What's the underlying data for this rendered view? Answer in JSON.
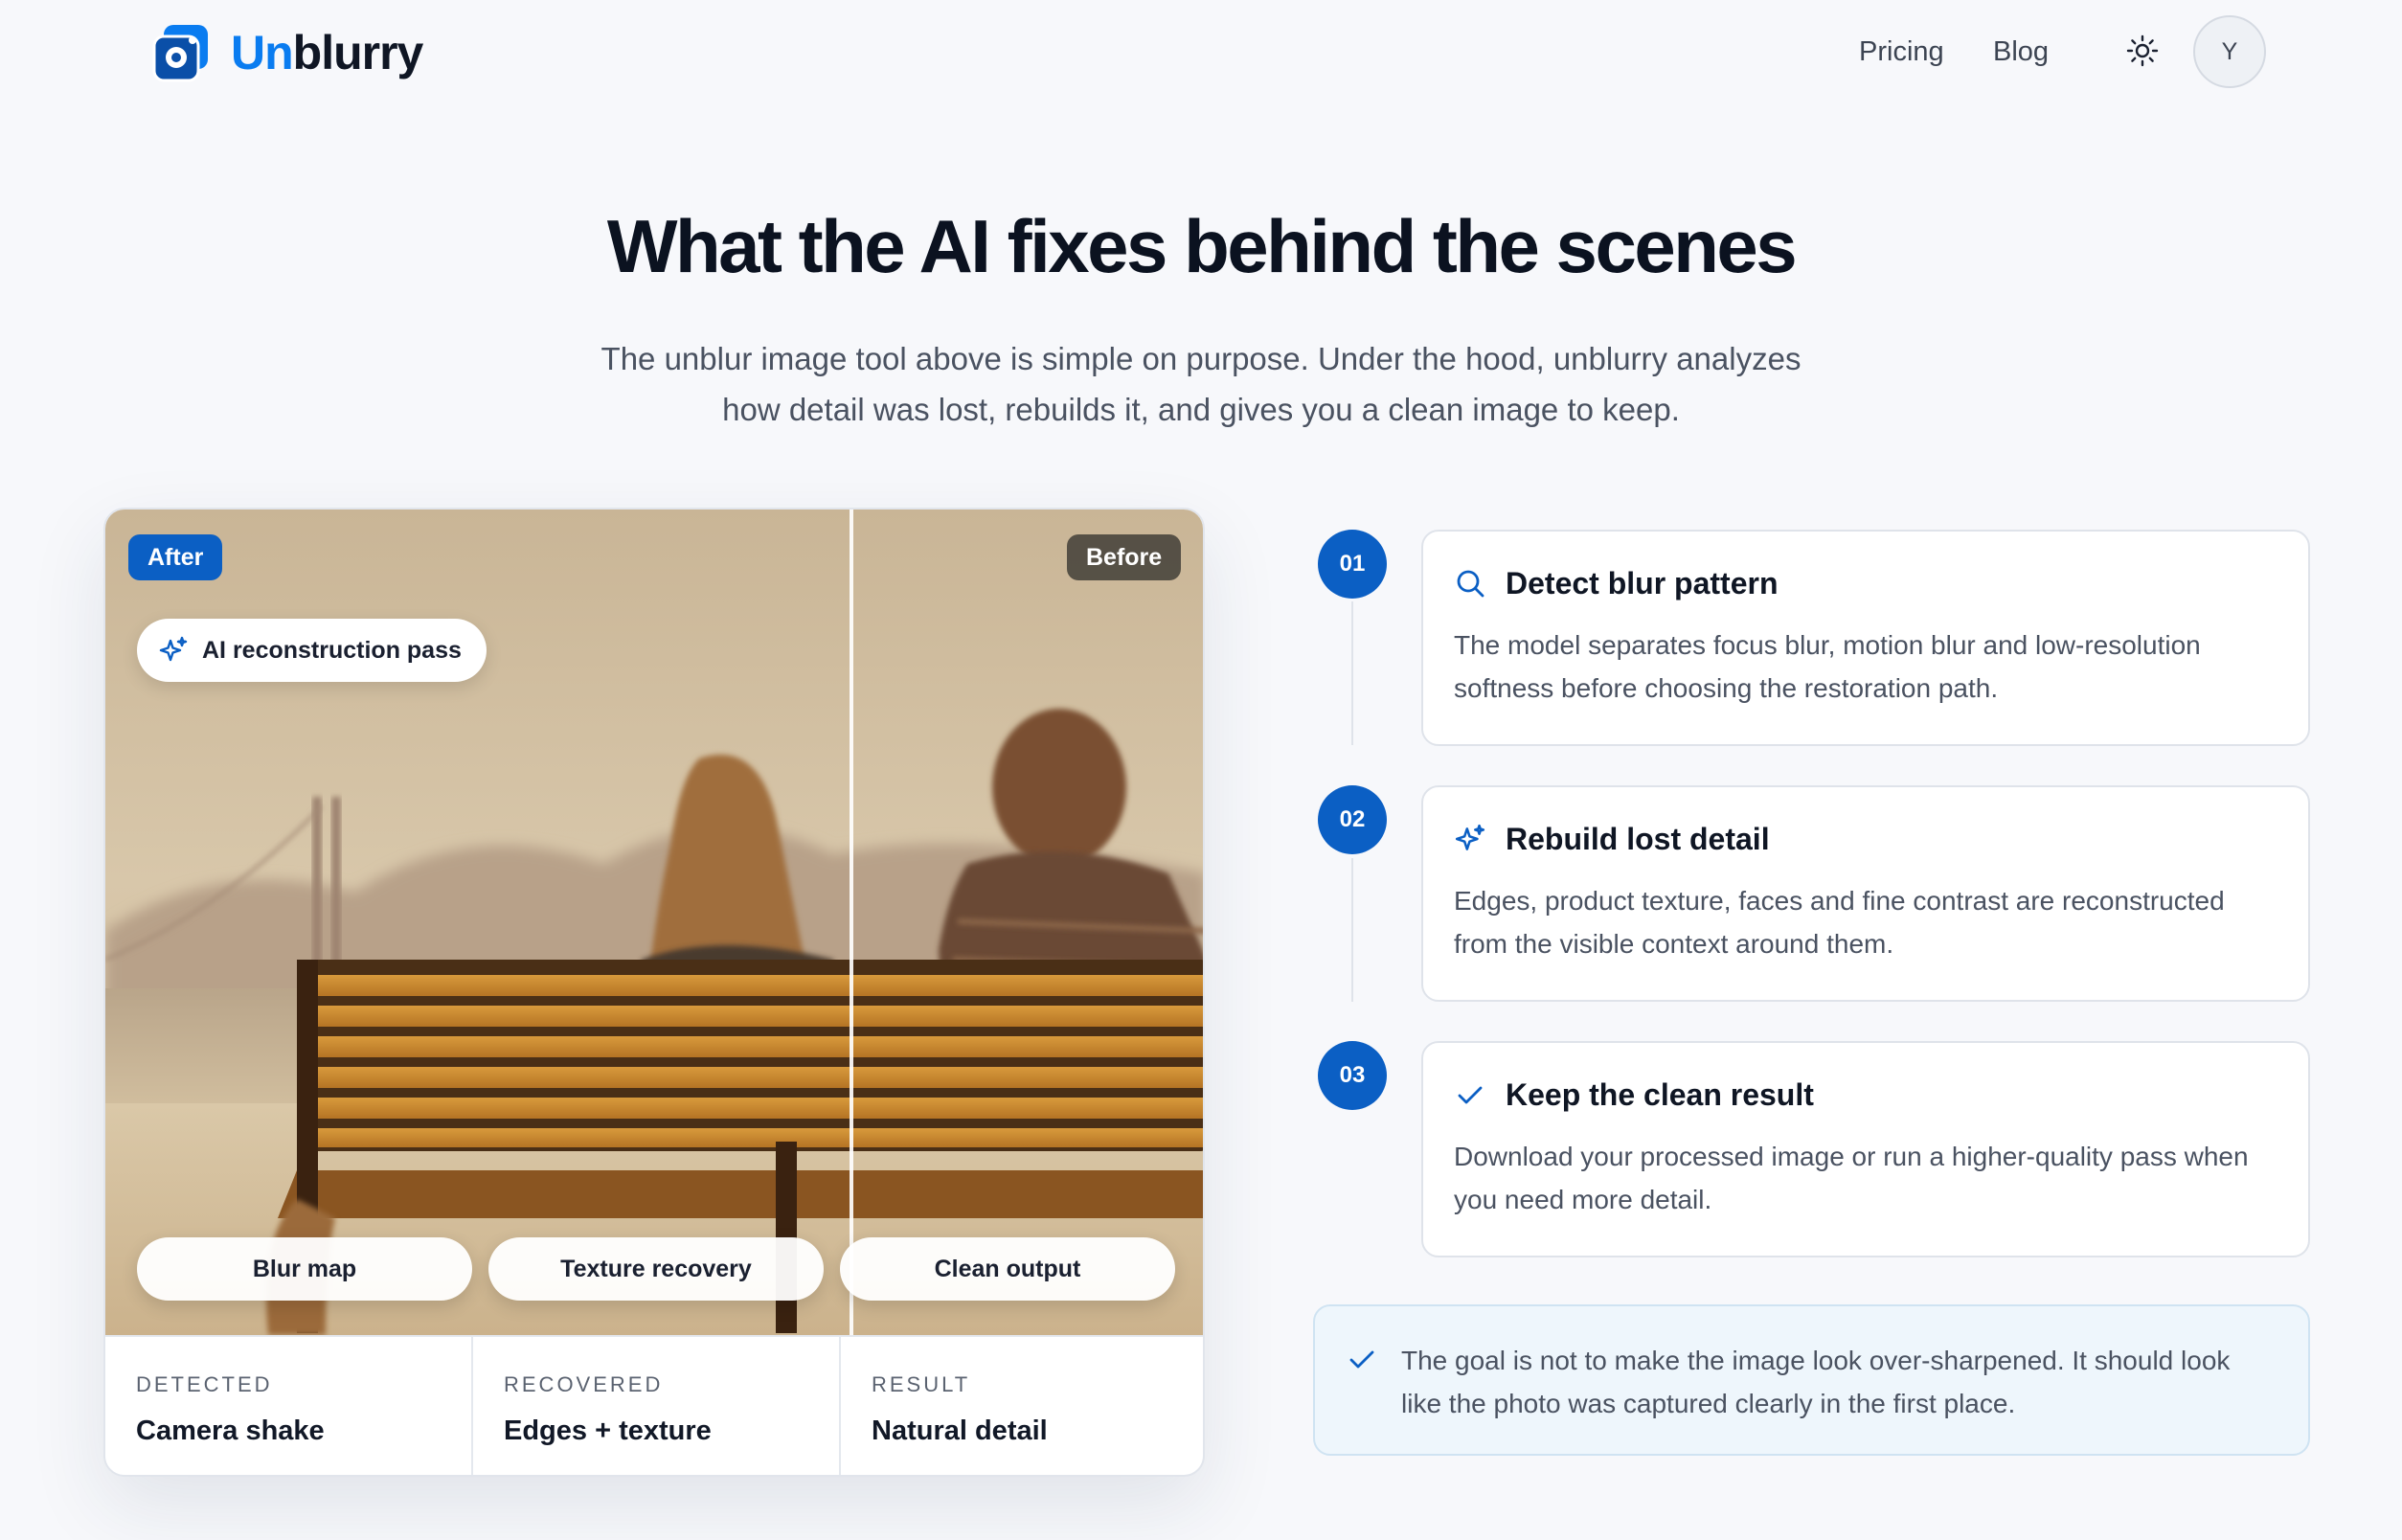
{
  "header": {
    "brand_prefix": "Un",
    "brand_suffix": "blurry",
    "nav": {
      "pricing": "Pricing",
      "blog": "Blog"
    },
    "theme_icon": "sun-icon",
    "avatar_initial": "Y"
  },
  "hero": {
    "title": "What the AI fixes behind the scenes",
    "subtitle_line1": "The unblur image tool above is simple on purpose. Under the hood, unblurry analyzes",
    "subtitle_line2": "how detail was lost, rebuilds it, and gives you a clean image to keep."
  },
  "compare": {
    "badge_after": "After",
    "badge_before": "Before",
    "ai_pill": "AI reconstruction pass",
    "chips": [
      "Blur map",
      "Texture recovery",
      "Clean output"
    ],
    "stats": [
      {
        "label": "DETECTED",
        "value": "Camera shake"
      },
      {
        "label": "RECOVERED",
        "value": "Edges + texture"
      },
      {
        "label": "RESULT",
        "value": "Natural detail"
      }
    ]
  },
  "steps": [
    {
      "num": "01",
      "icon": "search-icon",
      "title": "Detect blur pattern",
      "desc": "The model separates focus blur, motion blur and low-resolution softness before choosing the restoration path."
    },
    {
      "num": "02",
      "icon": "sparkle-icon",
      "title": "Rebuild lost detail",
      "desc": "Edges, product texture, faces and fine contrast are reconstructed from the visible context around them."
    },
    {
      "num": "03",
      "icon": "check-icon",
      "title": "Keep the clean result",
      "desc": "Download your processed image or run a higher-quality pass when you need more detail."
    }
  ],
  "note": {
    "icon": "check-icon",
    "text": "The goal is not to make the image look over-sharpened. It should look like the photo was captured clearly in the first place."
  },
  "colors": {
    "brand_blue": "#0a7cf0",
    "accent_blue": "#0b5fc4",
    "note_bg": "#eef6fc"
  }
}
